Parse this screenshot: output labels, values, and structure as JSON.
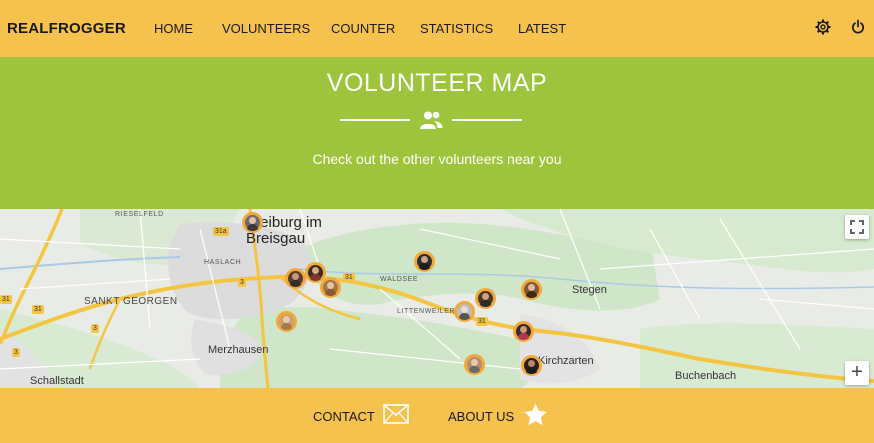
{
  "navbar": {
    "brand": "REALFROGGER",
    "links": [
      "HOME",
      "VOLUNTEERS",
      "COUNTER",
      "STATISTICS",
      "LATEST"
    ],
    "settings_icon": "gear-icon",
    "power_icon": "power-icon"
  },
  "hero": {
    "title": "VOLUNTEER MAP",
    "subtitle": "Check out the other volunteers near you",
    "icon": "users-icon"
  },
  "map": {
    "city": "Freiburg im Breisgau",
    "places": {
      "rieselfeld": "RIESELFELD",
      "haslach": "HASLACH",
      "sankt_georgen": "SANKT GEORGEN",
      "waldsee": "WALDSEE",
      "littenweiler": "LITTENWEILER",
      "merzhausen": "Merzhausen",
      "schallstadt": "Schallstadt",
      "stegen": "Stegen",
      "kirchzarten": "Kirchzarten",
      "buchenbach": "Buchenbach"
    },
    "routes": [
      "31a",
      "3",
      "31",
      "31",
      "31",
      "3",
      "3",
      "31"
    ],
    "volunteer_count": 14,
    "fullscreen_icon": "fullscreen-icon",
    "zoom_in_label": "+"
  },
  "footer": {
    "contact": "CONTACT",
    "about": "ABOUT US",
    "contact_icon": "envelope-icon",
    "about_icon": "star-icon"
  },
  "colors": {
    "nav_bg": "#f6c24e",
    "hero_bg": "#9dc43c",
    "marker": "#f2a93b"
  }
}
